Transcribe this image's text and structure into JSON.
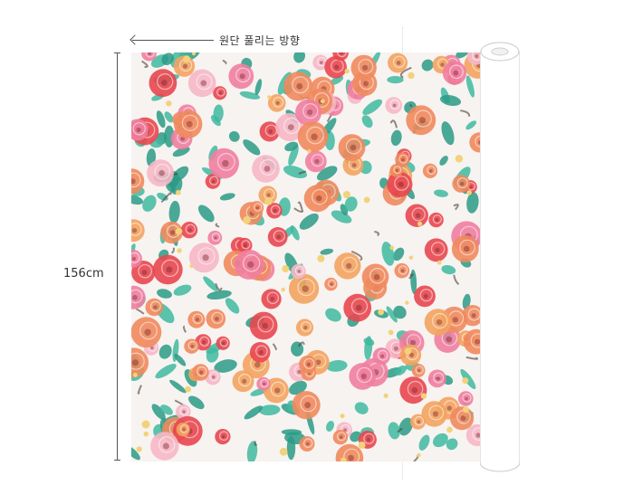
{
  "direction": {
    "label": "원단 풀리는 방향",
    "arrow_icon": "arrow-left-icon"
  },
  "dimension": {
    "width_label": "156cm"
  },
  "fabric": {
    "pattern": "watercolor-roses",
    "colors": {
      "background": "#f7f3f1",
      "leaf": "#3fb8a0",
      "leaf_dark": "#2a9a86",
      "rose_red": "#e8474f",
      "rose_pink": "#f07ea0",
      "rose_coral": "#f08a5d",
      "rose_orange": "#f3a35f",
      "rose_light": "#f6b7c7",
      "bud_yellow": "#f2d27a",
      "branch": "#4a4036"
    }
  },
  "roll": {
    "icon": "fabric-roll-icon",
    "color": "#ffffff",
    "outline": "#c9c9c9"
  }
}
